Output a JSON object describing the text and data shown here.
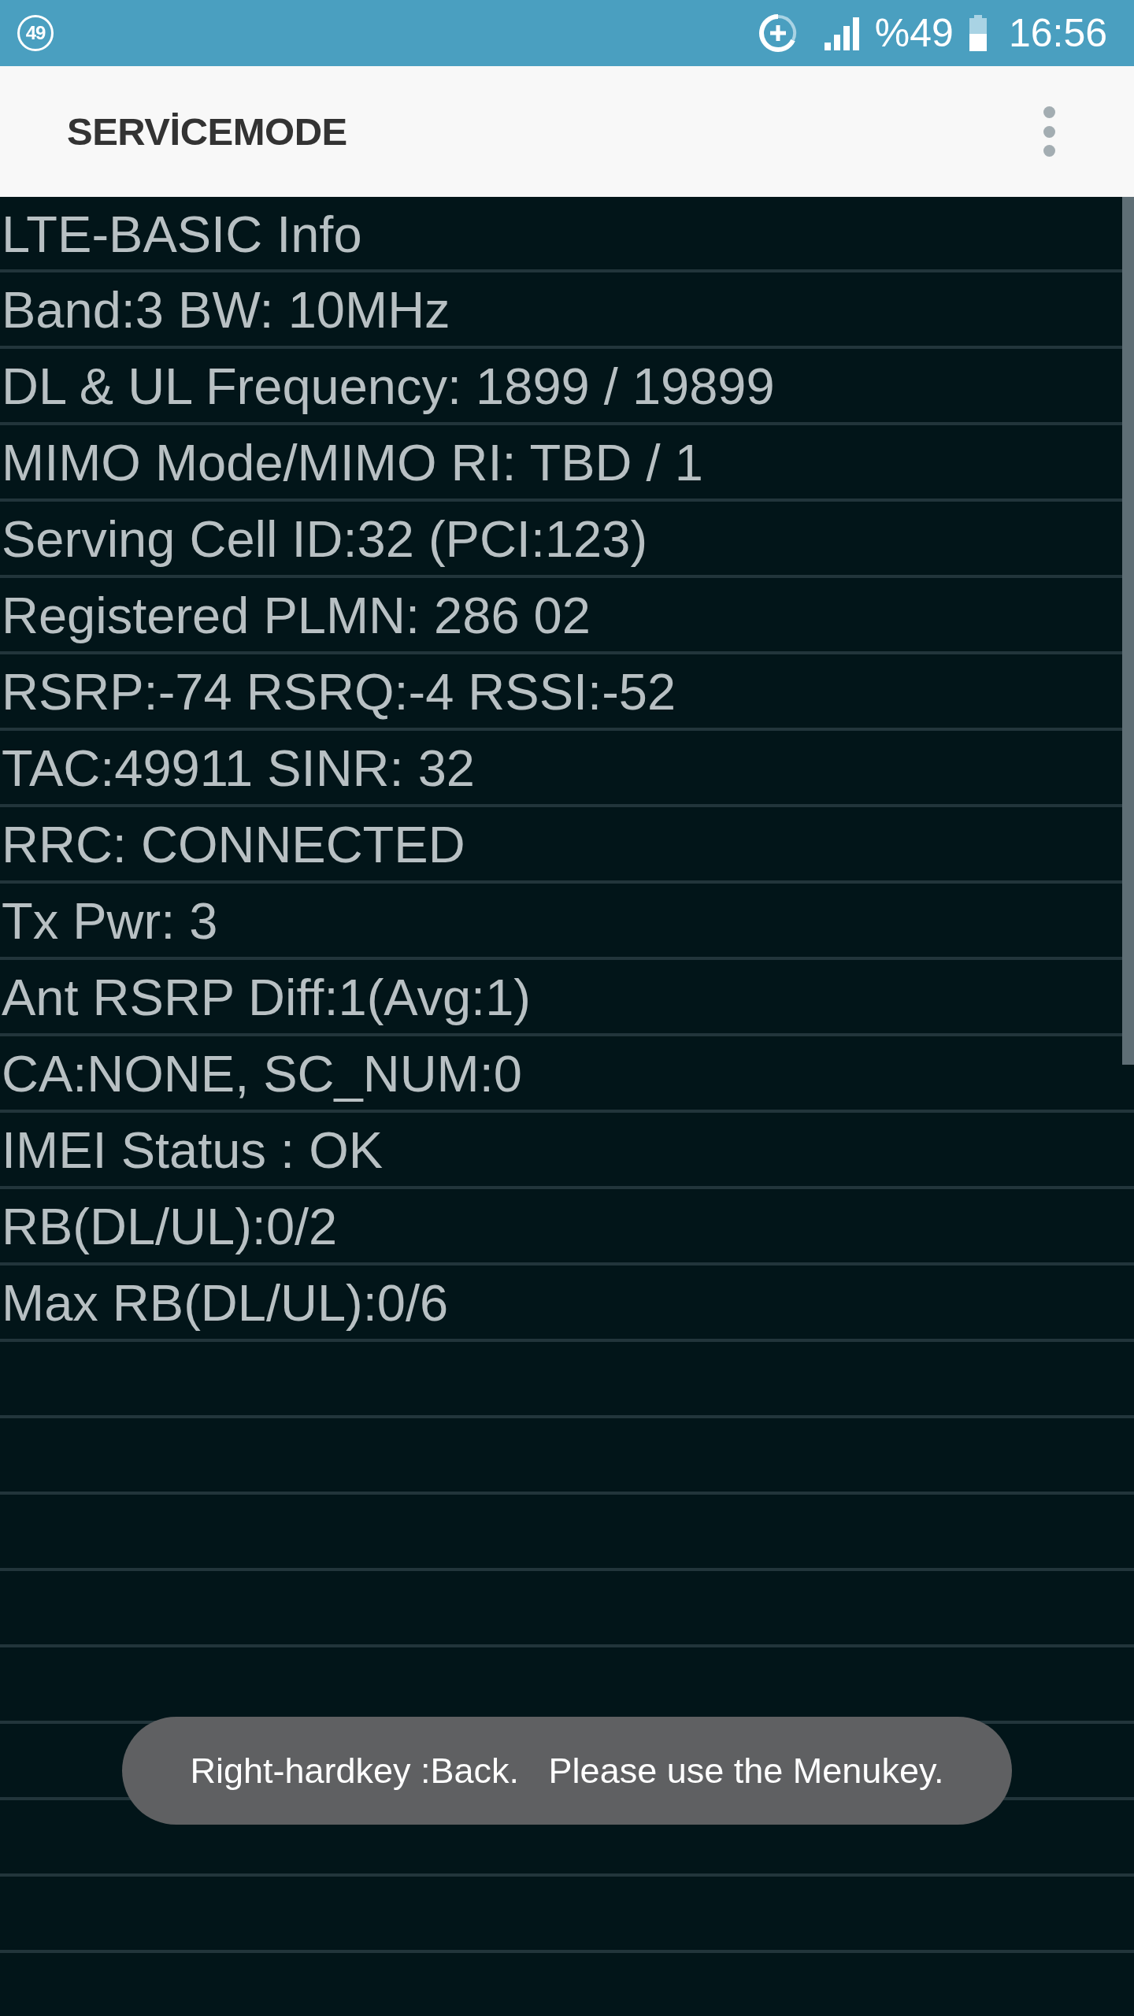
{
  "status_bar": {
    "notification_count": "49",
    "battery_percent": "%49",
    "time": "16:56"
  },
  "app_bar": {
    "title": "SERVİCEMODE"
  },
  "info_rows": [
    "LTE-BASIC Info",
    "Band:3 BW: 10MHz",
    "DL & UL Frequency: 1899 / 19899",
    "MIMO Mode/MIMO RI: TBD / 1",
    "Serving Cell ID:32 (PCI:123)",
    "Registered PLMN: 286 02",
    "RSRP:-74 RSRQ:-4 RSSI:-52",
    "TAC:49911 SINR: 32",
    "RRC: CONNECTED",
    "Tx Pwr: 3",
    "Ant RSRP Diff:1(Avg:1)",
    "CA:NONE, SC_NUM:0",
    "IMEI Status : OK",
    "RB(DL/UL):0/2",
    "Max RB(DL/UL):0/6"
  ],
  "toast": {
    "message": "Right-hardkey :Back.   Please use the Menukey."
  }
}
